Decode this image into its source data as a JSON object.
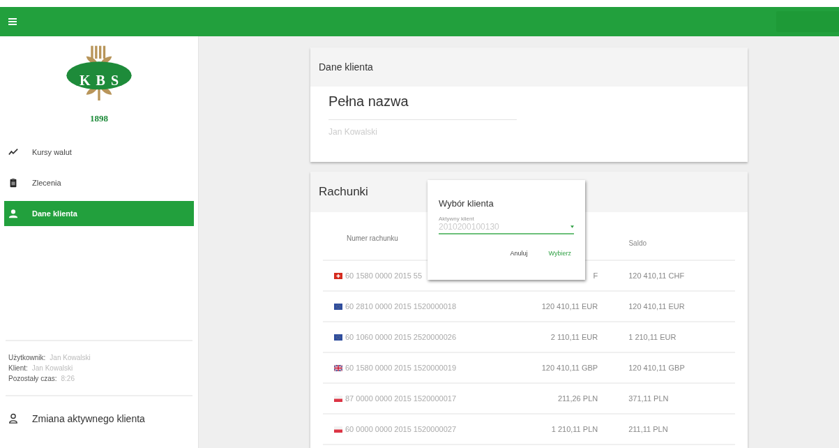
{
  "logo": {
    "letters": "KBS",
    "year": "1898"
  },
  "sidebar": {
    "items": [
      {
        "label": "Kursy walut",
        "selected": false
      },
      {
        "label": "Zlecenia",
        "selected": false
      },
      {
        "label": "Dane klienta",
        "selected": true
      }
    ],
    "session": [
      {
        "label": "Użytkownik:",
        "value": "Jan Kowalski"
      },
      {
        "label": "Klient:",
        "value": "Jan Kowalski"
      },
      {
        "label": "Pozostały czas:",
        "value": "8:26"
      }
    ],
    "change_client": "Zmiana aktywnego klienta"
  },
  "client_card": {
    "title": "Dane klienta",
    "field_label": "Pełna nazwa",
    "field_value": "Jan Kowalski"
  },
  "accounts": {
    "title": "Rachunki",
    "columns": [
      "Numer rachunku",
      "Saldo"
    ],
    "rows": [
      {
        "kind": "ch",
        "number": "60 1580 0000 2015 55",
        "available": "F",
        "balance": "120 410,11 CHF"
      },
      {
        "kind": "eu",
        "number": "60 2810 0000 2015 1520000018",
        "available": "120 410,11 EUR",
        "balance": "120 410,11 EUR"
      },
      {
        "kind": "eu",
        "number": "60 1060 0000 2015 2520000026",
        "available": "2 110,11 EUR",
        "balance": "1 210,11 EUR"
      },
      {
        "kind": "gb",
        "number": "60 1580 0000 2015 1520000019",
        "available": "120 410,11 GBP",
        "balance": "120 410,11 GBP"
      },
      {
        "kind": "pl",
        "number": "87 0000 0000 2015 1520000017",
        "available": "211,26 PLN",
        "balance": "371,11 PLN"
      },
      {
        "kind": "pl",
        "number": "60 0000 0000 2015 1520000027",
        "available": "1 210,11 PLN",
        "balance": "211,11 PLN"
      }
    ]
  },
  "dialog": {
    "title": "Wybór klienta",
    "field_label": "Aktywny klient",
    "field_value": "2010200100130",
    "buttons": [
      {
        "label": "Anuluj",
        "kind": "plain"
      },
      {
        "label": "Wybierz",
        "kind": "primary"
      }
    ]
  }
}
